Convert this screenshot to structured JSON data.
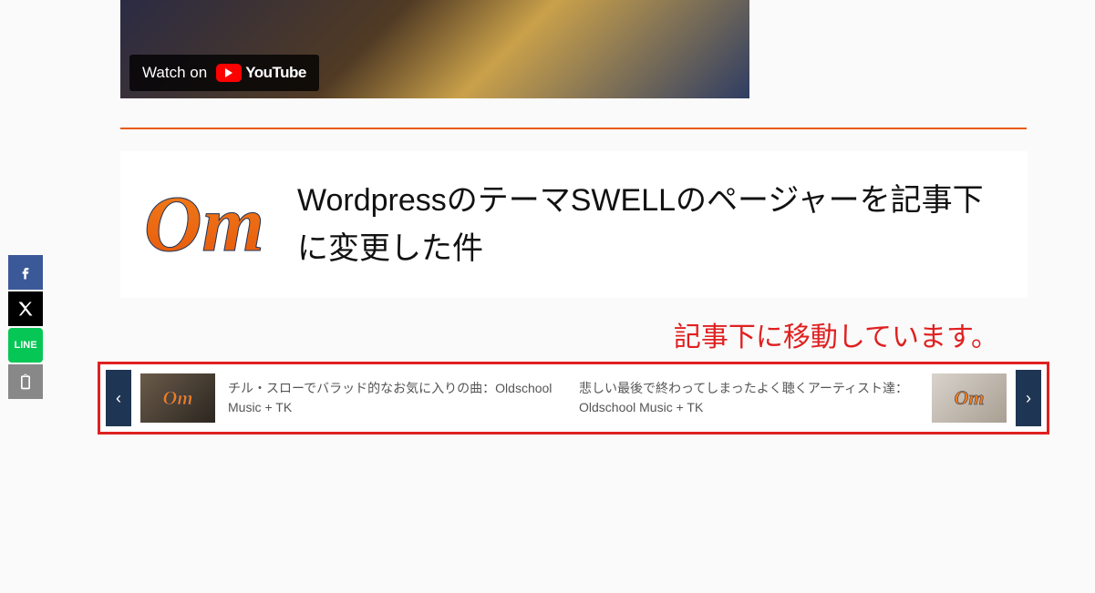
{
  "share": {
    "facebook_icon": "facebook-icon",
    "x_icon": "x-icon",
    "line_icon": "line-icon",
    "clipboard_icon": "clipboard-icon"
  },
  "video": {
    "watch_on_label": "Watch on",
    "youtube_label": "YouTube"
  },
  "article": {
    "logo_text": "Om",
    "title": "WordpressのテーマSWELLのページャーを記事下に変更した件"
  },
  "annotation": "記事下に移動しています。",
  "pager": {
    "prev": {
      "title": "チル・スローでバラッド的なお気に入りの曲：Oldschool Music + TK",
      "logo": "Om"
    },
    "next": {
      "title": "悲しい最後で終わってしまったよく聴くアーティスト達：Oldschool Music + TK",
      "logo": "Om"
    },
    "arrow_left": "‹",
    "arrow_right": "›"
  }
}
